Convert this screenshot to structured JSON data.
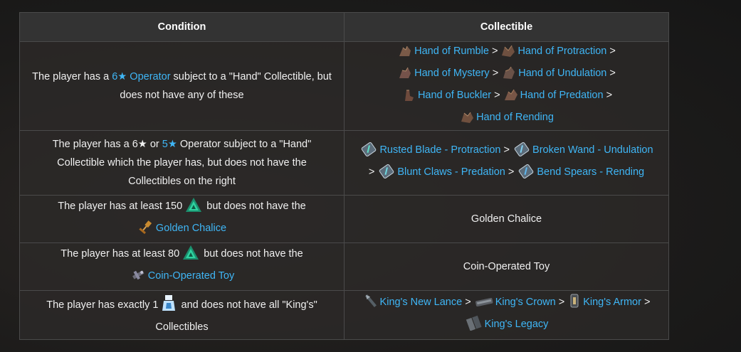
{
  "table": {
    "headers": {
      "condition": "Condition",
      "collectible": "Collectible"
    },
    "rows": [
      {
        "condition": {
          "pre": "The player has a ",
          "link": "6★ Operator",
          "mid": " subject to a \"Hand\" Collectible, but",
          "post": "does not have any of these"
        },
        "collectibles": [
          "Hand of Rumble",
          "Hand of Protraction",
          "Hand of Mystery",
          "Hand of Undulation",
          "Hand of Buckler",
          "Hand of Predation",
          "Hand of Rending"
        ]
      },
      {
        "condition": {
          "pre": "The player has a 6★ or ",
          "link": "5★",
          "mid": " Operator subject to a \"Hand\"",
          "line2": "Collectible which the player has, but does not have the",
          "line3": "Collectibles on the right"
        },
        "collectibles": [
          "Rusted Blade - Protraction",
          "Broken Wand - Undulation",
          "Blunt Claws - Predation",
          "Bend Spears - Rending"
        ]
      },
      {
        "condition": {
          "pre": "The player has at least 150",
          "post": "but does not have the",
          "link": "Golden Chalice"
        },
        "collectible": "Golden Chalice"
      },
      {
        "condition": {
          "pre": "The player has at least 80",
          "post": "but does not have the",
          "link": "Coin-Operated Toy"
        },
        "collectible": "Coin-Operated Toy"
      },
      {
        "condition": {
          "pre": "The player has exactly 1",
          "post": "and does not have all \"King's\"",
          "line2": "Collectibles"
        },
        "collectibles": [
          "King's New Lance",
          "King's Crown",
          "King's Armor",
          "King's Legacy"
        ]
      }
    ],
    "separator": ">"
  },
  "colors": {
    "link": "#3fb6f6",
    "header_bg": "#333333",
    "border": "#4a4a4a"
  }
}
